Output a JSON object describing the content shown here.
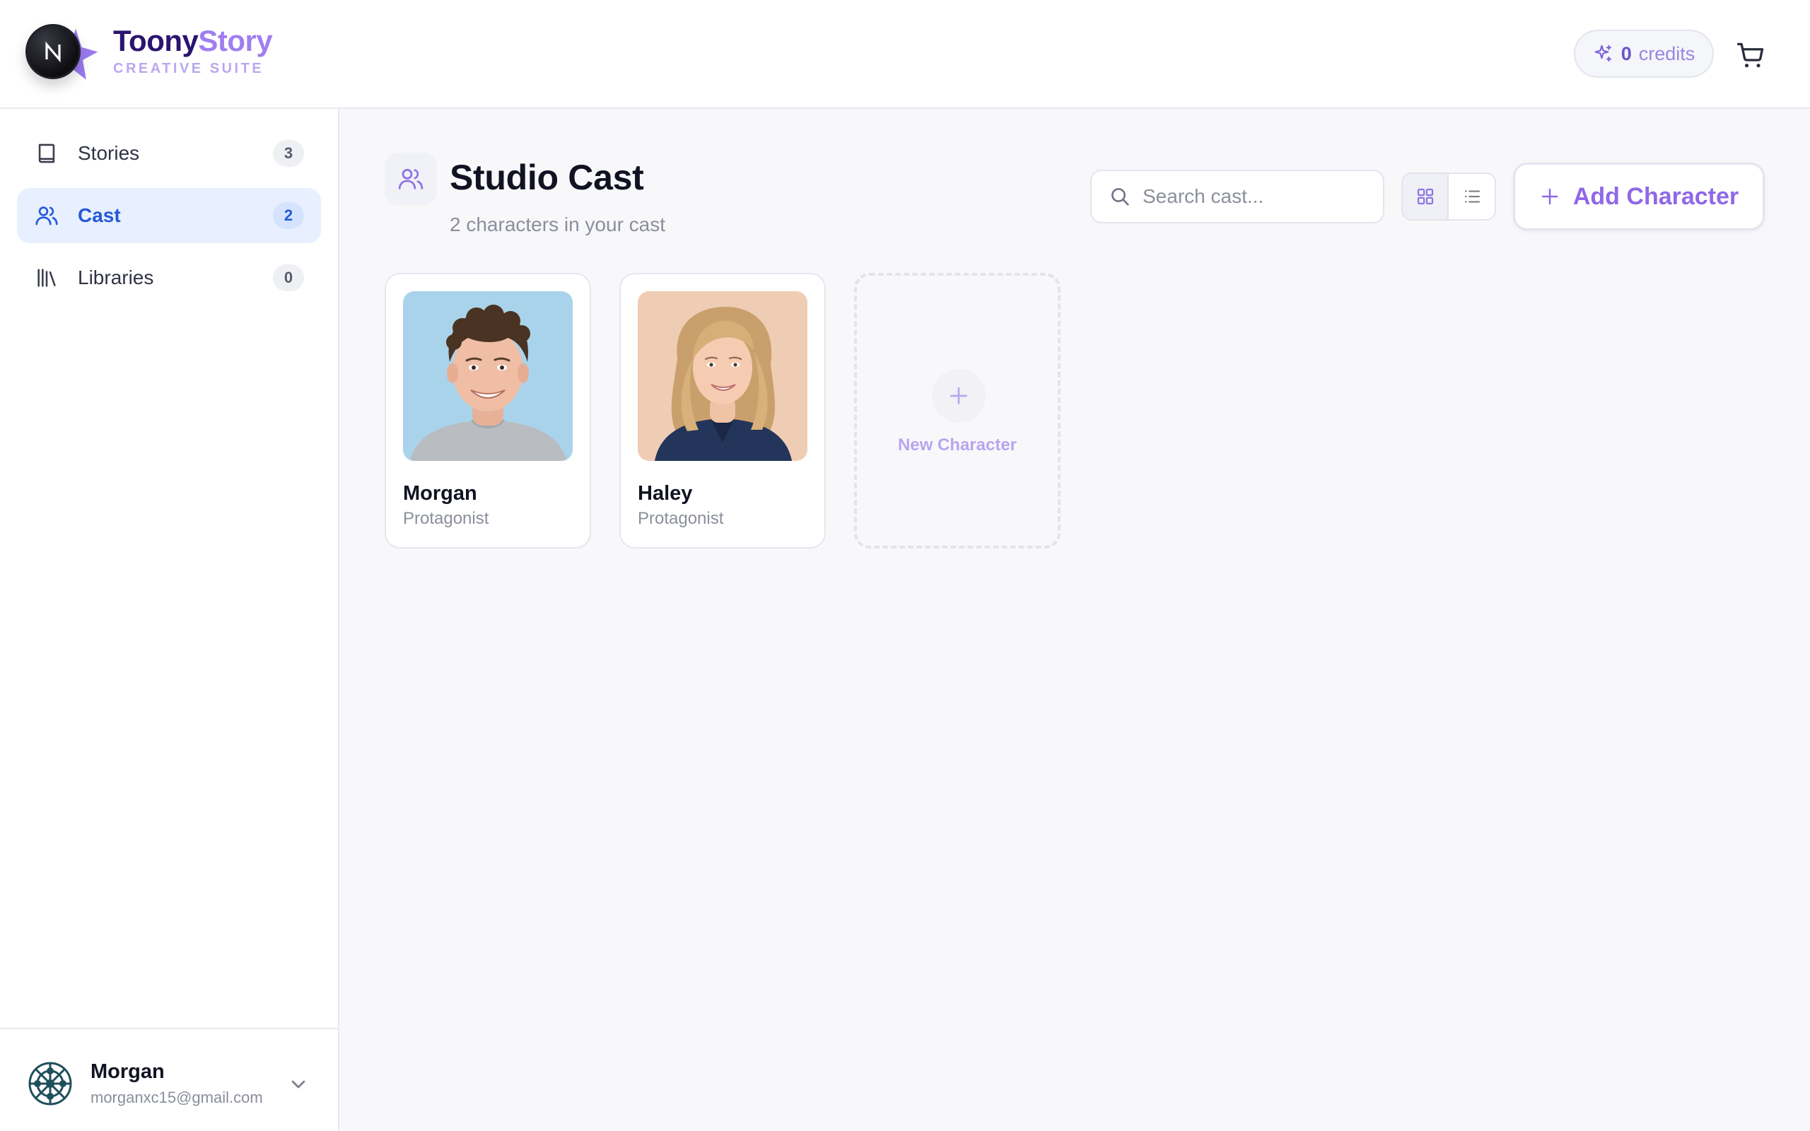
{
  "header": {
    "brand_part1": "Toony",
    "brand_part2": "Story",
    "brand_subtitle": "CREATIVE SUITE",
    "logo_letter": "N",
    "credits_value": "0",
    "credits_label": "credits",
    "icons": {
      "credits": "sparkles-icon",
      "cart": "cart-icon"
    }
  },
  "sidebar": {
    "items": [
      {
        "label": "Stories",
        "count": "3",
        "icon": "book-icon",
        "active": false
      },
      {
        "label": "Cast",
        "count": "2",
        "icon": "users-icon",
        "active": true
      },
      {
        "label": "Libraries",
        "count": "0",
        "icon": "library-icon",
        "active": false
      }
    ],
    "user": {
      "name": "Morgan",
      "email": "morganxc15@gmail.com"
    }
  },
  "main": {
    "title": "Studio Cast",
    "subtitle": "2 characters in your cast",
    "search_placeholder": "Search cast...",
    "add_button_label": "Add Character",
    "view_mode": "grid",
    "characters": [
      {
        "name": "Morgan",
        "role": "Protagonist"
      },
      {
        "name": "Haley",
        "role": "Protagonist"
      }
    ],
    "new_character_label": "New Character"
  },
  "colors": {
    "accent": "#9068e6",
    "brand_dark": "#2a1470",
    "active_nav": "#2559d8",
    "active_nav_bg": "#e8f0ff"
  }
}
